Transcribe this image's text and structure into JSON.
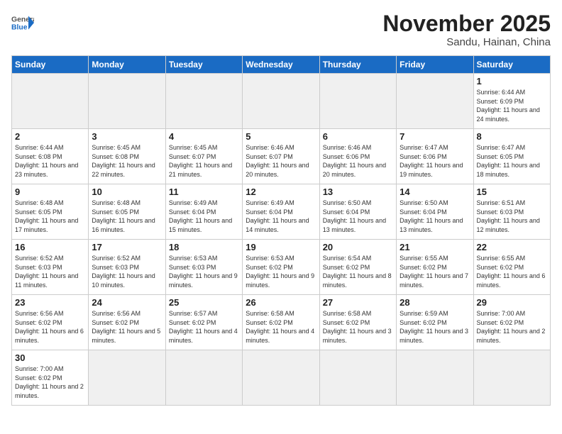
{
  "header": {
    "logo_general": "General",
    "logo_blue": "Blue",
    "month": "November 2025",
    "location": "Sandu, Hainan, China"
  },
  "days_of_week": [
    "Sunday",
    "Monday",
    "Tuesday",
    "Wednesday",
    "Thursday",
    "Friday",
    "Saturday"
  ],
  "weeks": [
    [
      {
        "day": "",
        "info": ""
      },
      {
        "day": "",
        "info": ""
      },
      {
        "day": "",
        "info": ""
      },
      {
        "day": "",
        "info": ""
      },
      {
        "day": "",
        "info": ""
      },
      {
        "day": "",
        "info": ""
      },
      {
        "day": "1",
        "info": "Sunrise: 6:44 AM\nSunset: 6:09 PM\nDaylight: 11 hours\nand 24 minutes."
      }
    ],
    [
      {
        "day": "2",
        "info": "Sunrise: 6:44 AM\nSunset: 6:08 PM\nDaylight: 11 hours\nand 23 minutes."
      },
      {
        "day": "3",
        "info": "Sunrise: 6:45 AM\nSunset: 6:08 PM\nDaylight: 11 hours\nand 22 minutes."
      },
      {
        "day": "4",
        "info": "Sunrise: 6:45 AM\nSunset: 6:07 PM\nDaylight: 11 hours\nand 21 minutes."
      },
      {
        "day": "5",
        "info": "Sunrise: 6:46 AM\nSunset: 6:07 PM\nDaylight: 11 hours\nand 20 minutes."
      },
      {
        "day": "6",
        "info": "Sunrise: 6:46 AM\nSunset: 6:06 PM\nDaylight: 11 hours\nand 20 minutes."
      },
      {
        "day": "7",
        "info": "Sunrise: 6:47 AM\nSunset: 6:06 PM\nDaylight: 11 hours\nand 19 minutes."
      },
      {
        "day": "8",
        "info": "Sunrise: 6:47 AM\nSunset: 6:05 PM\nDaylight: 11 hours\nand 18 minutes."
      }
    ],
    [
      {
        "day": "9",
        "info": "Sunrise: 6:48 AM\nSunset: 6:05 PM\nDaylight: 11 hours\nand 17 minutes."
      },
      {
        "day": "10",
        "info": "Sunrise: 6:48 AM\nSunset: 6:05 PM\nDaylight: 11 hours\nand 16 minutes."
      },
      {
        "day": "11",
        "info": "Sunrise: 6:49 AM\nSunset: 6:04 PM\nDaylight: 11 hours\nand 15 minutes."
      },
      {
        "day": "12",
        "info": "Sunrise: 6:49 AM\nSunset: 6:04 PM\nDaylight: 11 hours\nand 14 minutes."
      },
      {
        "day": "13",
        "info": "Sunrise: 6:50 AM\nSunset: 6:04 PM\nDaylight: 11 hours\nand 13 minutes."
      },
      {
        "day": "14",
        "info": "Sunrise: 6:50 AM\nSunset: 6:04 PM\nDaylight: 11 hours\nand 13 minutes."
      },
      {
        "day": "15",
        "info": "Sunrise: 6:51 AM\nSunset: 6:03 PM\nDaylight: 11 hours\nand 12 minutes."
      }
    ],
    [
      {
        "day": "16",
        "info": "Sunrise: 6:52 AM\nSunset: 6:03 PM\nDaylight: 11 hours\nand 11 minutes."
      },
      {
        "day": "17",
        "info": "Sunrise: 6:52 AM\nSunset: 6:03 PM\nDaylight: 11 hours\nand 10 minutes."
      },
      {
        "day": "18",
        "info": "Sunrise: 6:53 AM\nSunset: 6:03 PM\nDaylight: 11 hours\nand 9 minutes."
      },
      {
        "day": "19",
        "info": "Sunrise: 6:53 AM\nSunset: 6:02 PM\nDaylight: 11 hours\nand 9 minutes."
      },
      {
        "day": "20",
        "info": "Sunrise: 6:54 AM\nSunset: 6:02 PM\nDaylight: 11 hours\nand 8 minutes."
      },
      {
        "day": "21",
        "info": "Sunrise: 6:55 AM\nSunset: 6:02 PM\nDaylight: 11 hours\nand 7 minutes."
      },
      {
        "day": "22",
        "info": "Sunrise: 6:55 AM\nSunset: 6:02 PM\nDaylight: 11 hours\nand 6 minutes."
      }
    ],
    [
      {
        "day": "23",
        "info": "Sunrise: 6:56 AM\nSunset: 6:02 PM\nDaylight: 11 hours\nand 6 minutes."
      },
      {
        "day": "24",
        "info": "Sunrise: 6:56 AM\nSunset: 6:02 PM\nDaylight: 11 hours\nand 5 minutes."
      },
      {
        "day": "25",
        "info": "Sunrise: 6:57 AM\nSunset: 6:02 PM\nDaylight: 11 hours\nand 4 minutes."
      },
      {
        "day": "26",
        "info": "Sunrise: 6:58 AM\nSunset: 6:02 PM\nDaylight: 11 hours\nand 4 minutes."
      },
      {
        "day": "27",
        "info": "Sunrise: 6:58 AM\nSunset: 6:02 PM\nDaylight: 11 hours\nand 3 minutes."
      },
      {
        "day": "28",
        "info": "Sunrise: 6:59 AM\nSunset: 6:02 PM\nDaylight: 11 hours\nand 3 minutes."
      },
      {
        "day": "29",
        "info": "Sunrise: 7:00 AM\nSunset: 6:02 PM\nDaylight: 11 hours\nand 2 minutes."
      }
    ],
    [
      {
        "day": "30",
        "info": "Sunrise: 7:00 AM\nSunset: 6:02 PM\nDaylight: 11 hours\nand 2 minutes."
      },
      {
        "day": "",
        "info": ""
      },
      {
        "day": "",
        "info": ""
      },
      {
        "day": "",
        "info": ""
      },
      {
        "day": "",
        "info": ""
      },
      {
        "day": "",
        "info": ""
      },
      {
        "day": "",
        "info": ""
      }
    ]
  ]
}
